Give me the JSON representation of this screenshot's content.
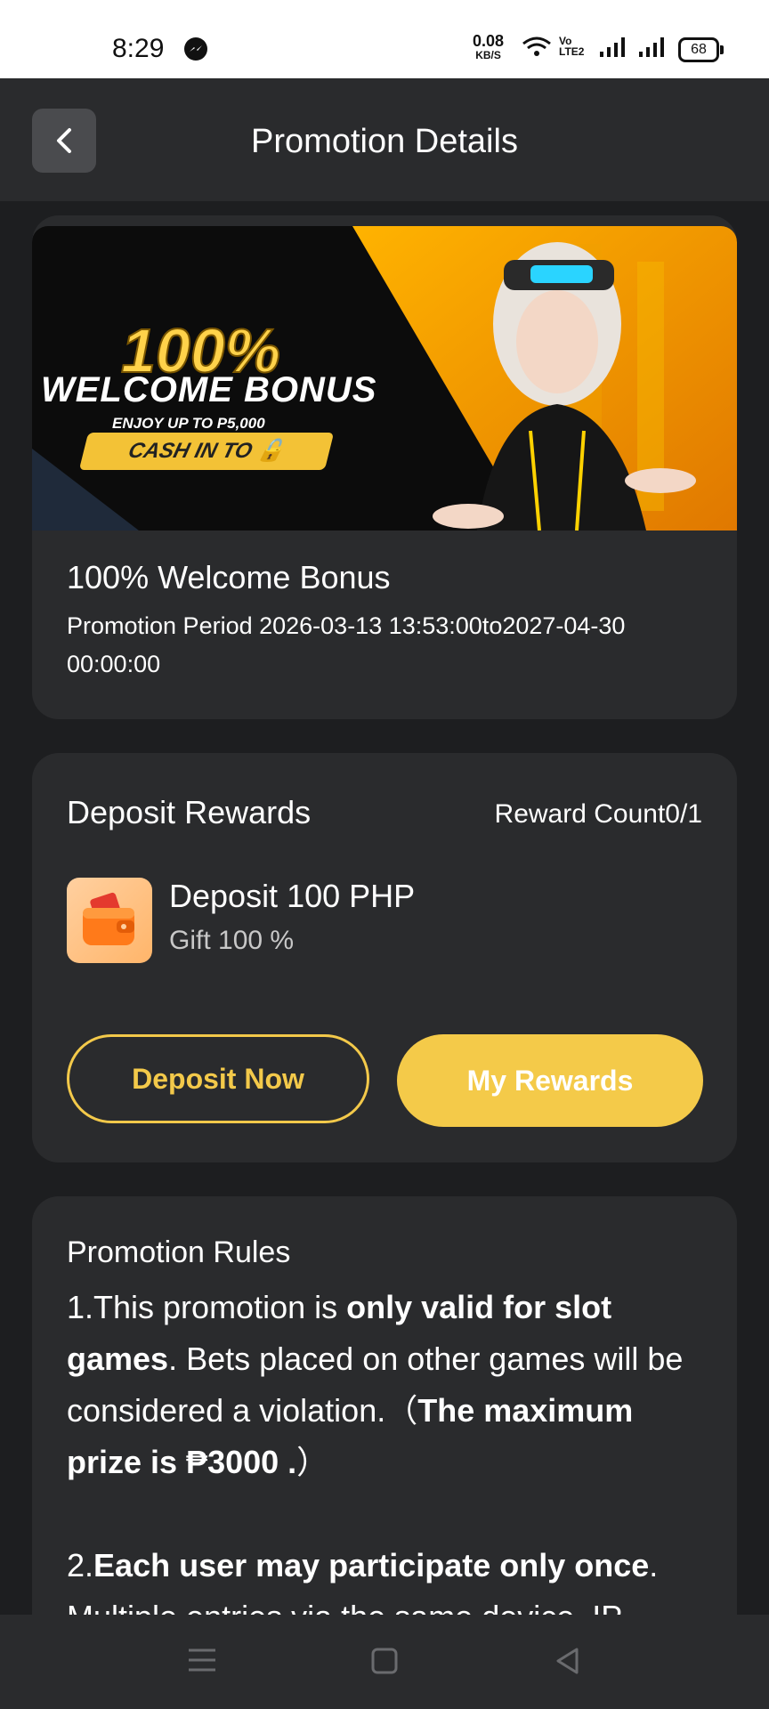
{
  "status_bar": {
    "time": "8:29",
    "net_speed": "0.08",
    "net_unit": "KB/S",
    "volte": "VoLTE2",
    "battery": "68"
  },
  "header": {
    "title": "Promotion Details"
  },
  "promo": {
    "banner": {
      "big": "100%",
      "welcome": "WELCOME BONUS",
      "sub": "ENJOY UP TO P5,000",
      "cta": "CASH IN TO"
    },
    "title": "100% Welcome Bonus",
    "period": "Promotion Period 2026-03-13 13:53:00to2027-04-30 00:00:00"
  },
  "deposit": {
    "title": "Deposit Rewards",
    "reward_count": "Reward Count0/1",
    "amount": "Deposit 100 PHP",
    "gift": "Gift 100 %",
    "deposit_button": "Deposit Now",
    "rewards_button": "My Rewards"
  },
  "rules": {
    "title": "Promotion Rules",
    "r1_a": "1.This promotion is ",
    "r1_b": "only valid for slot games",
    "r1_c": ". Bets placed on other games will be considered a violation.（",
    "r1_d": "The maximum prize is ₱3000 .",
    "r1_e": "）",
    "r2_a": "2.",
    "r2_b": "Each user may participate only once",
    "r2_c": ".",
    "r2_d": "Multiple entries via the same device, IP"
  },
  "colors": {
    "accent": "#f4ca49",
    "background": "#1d1e20",
    "card": "#2a2b2d"
  },
  "icons": [
    "messenger-icon",
    "wifi-icon",
    "signal-icon",
    "back-icon",
    "wallet-icon",
    "menu-icon",
    "home-icon",
    "back-nav-icon"
  ]
}
